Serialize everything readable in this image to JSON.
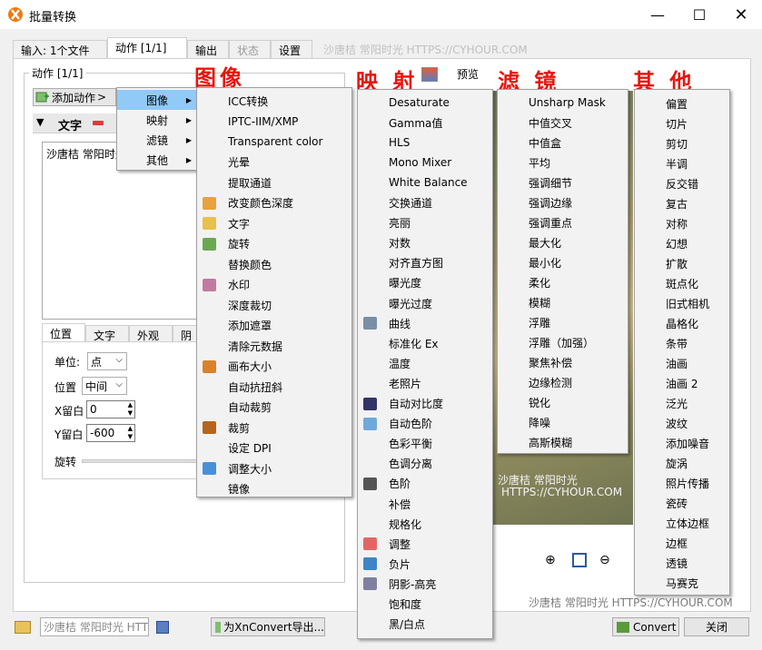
{
  "window": {
    "title": "批量转换"
  },
  "tabs": [
    {
      "label": "输入: 1个文件"
    },
    {
      "label": "动作 [1/1]"
    },
    {
      "label": "输出"
    },
    {
      "label": "状态"
    },
    {
      "label": "设置"
    }
  ],
  "watermarks": {
    "tabs": "沙唐桔 常阳时光 HTTPS://CYHOUR.COM",
    "bottom": "沙唐桔 常阳时光 HTTPS://CYHOUR.COM",
    "photo_line1": "沙唐桔 常阳时光",
    "photo_line2": "HTTPS://CYHOUR.COM",
    "footer_combo": "沙唐桔 常阳时光 HTTPS://CYHOUR.COM"
  },
  "actions_panel": {
    "group_title": "动作 [1/1]",
    "add_action_label": "添加动作",
    "text_action_label": "文字",
    "text_value": "沙唐桔 常阳时光",
    "preview_label": "预览"
  },
  "red_labels": {
    "image": "图像",
    "mapping": "映 射",
    "filter": "滤 镜",
    "other": "其 他"
  },
  "submenu_root": [
    {
      "label": "图像"
    },
    {
      "label": "映射"
    },
    {
      "label": "滤镜"
    },
    {
      "label": "其他"
    }
  ],
  "image_menu": [
    {
      "label": "ICC转换",
      "icon": ""
    },
    {
      "label": "IPTC-IIM/XMP",
      "icon": ""
    },
    {
      "label": "Transparent color",
      "icon": ""
    },
    {
      "label": "光晕",
      "icon": ""
    },
    {
      "label": "提取通道",
      "icon": ""
    },
    {
      "label": "改变颜色深度",
      "icon": "color-depth-icon"
    },
    {
      "label": "文字",
      "icon": "text-icon"
    },
    {
      "label": "旋转",
      "icon": "rotate-icon"
    },
    {
      "label": "替换颜色",
      "icon": ""
    },
    {
      "label": "水印",
      "icon": "watermark-icon"
    },
    {
      "label": "深度裁切",
      "icon": ""
    },
    {
      "label": "添加遮罩",
      "icon": ""
    },
    {
      "label": "清除元数据",
      "icon": ""
    },
    {
      "label": "画布大小",
      "icon": "canvas-icon"
    },
    {
      "label": "自动抗扭斜",
      "icon": ""
    },
    {
      "label": "自动裁剪",
      "icon": ""
    },
    {
      "label": "裁剪",
      "icon": "crop-icon"
    },
    {
      "label": "设定 DPI",
      "icon": ""
    },
    {
      "label": "调整大小",
      "icon": "resize-icon"
    },
    {
      "label": "镜像",
      "icon": ""
    }
  ],
  "mapping_menu": [
    {
      "label": "Desaturate",
      "icon": ""
    },
    {
      "label": "Gamma值",
      "icon": ""
    },
    {
      "label": "HLS",
      "icon": ""
    },
    {
      "label": "Mono Mixer",
      "icon": ""
    },
    {
      "label": "White Balance",
      "icon": ""
    },
    {
      "label": "交换通道",
      "icon": ""
    },
    {
      "label": "亮丽",
      "icon": ""
    },
    {
      "label": "对数",
      "icon": ""
    },
    {
      "label": "对齐直方图",
      "icon": ""
    },
    {
      "label": "曝光度",
      "icon": ""
    },
    {
      "label": "曝光过度",
      "icon": ""
    },
    {
      "label": "曲线",
      "icon": "curves-icon"
    },
    {
      "label": "标准化 Ex",
      "icon": ""
    },
    {
      "label": "温度",
      "icon": ""
    },
    {
      "label": "老照片",
      "icon": ""
    },
    {
      "label": "自动对比度",
      "icon": "contrast-icon"
    },
    {
      "label": "自动色阶",
      "icon": "levels-icon"
    },
    {
      "label": "色彩平衡",
      "icon": ""
    },
    {
      "label": "色调分离",
      "icon": ""
    },
    {
      "label": "色阶",
      "icon": "levels2-icon"
    },
    {
      "label": "补偿",
      "icon": ""
    },
    {
      "label": "规格化",
      "icon": ""
    },
    {
      "label": "调整",
      "icon": "adjust-icon"
    },
    {
      "label": "负片",
      "icon": "negative-icon"
    },
    {
      "label": "阴影-高亮",
      "icon": "shadow-highlight-icon"
    },
    {
      "label": "饱和度",
      "icon": ""
    },
    {
      "label": "黑/白点",
      "icon": ""
    }
  ],
  "filter_menu": [
    {
      "label": "Unsharp Mask"
    },
    {
      "label": "中值交叉"
    },
    {
      "label": "中值盒"
    },
    {
      "label": "平均"
    },
    {
      "label": "强调细节"
    },
    {
      "label": "强调边缘"
    },
    {
      "label": "强调重点"
    },
    {
      "label": "最大化"
    },
    {
      "label": "最小化"
    },
    {
      "label": "柔化"
    },
    {
      "label": "模糊"
    },
    {
      "label": "浮雕"
    },
    {
      "label": "浮雕（加强）"
    },
    {
      "label": "聚焦补偿"
    },
    {
      "label": "边缘检测"
    },
    {
      "label": "锐化"
    },
    {
      "label": "降噪"
    },
    {
      "label": "高斯模糊"
    }
  ],
  "other_menu": [
    {
      "label": "偏置"
    },
    {
      "label": "切片"
    },
    {
      "label": "剪切"
    },
    {
      "label": "半调"
    },
    {
      "label": "反交错"
    },
    {
      "label": "复古"
    },
    {
      "label": "对称"
    },
    {
      "label": "幻想"
    },
    {
      "label": "扩散"
    },
    {
      "label": "斑点化"
    },
    {
      "label": "旧式相机"
    },
    {
      "label": "晶格化"
    },
    {
      "label": "条带"
    },
    {
      "label": "油画"
    },
    {
      "label": "油画 2"
    },
    {
      "label": "泛光"
    },
    {
      "label": "波纹"
    },
    {
      "label": "添加噪音"
    },
    {
      "label": "旋涡"
    },
    {
      "label": "照片传播"
    },
    {
      "label": "瓷砖"
    },
    {
      "label": "立体边框"
    },
    {
      "label": "边框"
    },
    {
      "label": "透镜"
    },
    {
      "label": "马赛克"
    }
  ],
  "props": {
    "tabs": [
      {
        "label": "位置"
      },
      {
        "label": "文字"
      },
      {
        "label": "外观"
      },
      {
        "label": "阴"
      }
    ],
    "unit_label": "单位:",
    "unit_value": "点",
    "position_label": "位置",
    "position_value": "中间",
    "x_margin_label": "X留白",
    "x_margin_value": "0",
    "y_margin_label": "Y留白",
    "y_margin_value": "-600",
    "rotate_label": "旋转"
  },
  "footer": {
    "export_label": "为XnConvert导出...",
    "convert_label": "Convert",
    "close_label": "关闭"
  },
  "colors": {
    "red_label": "#e8150c",
    "highlight": "#91c9f7"
  }
}
